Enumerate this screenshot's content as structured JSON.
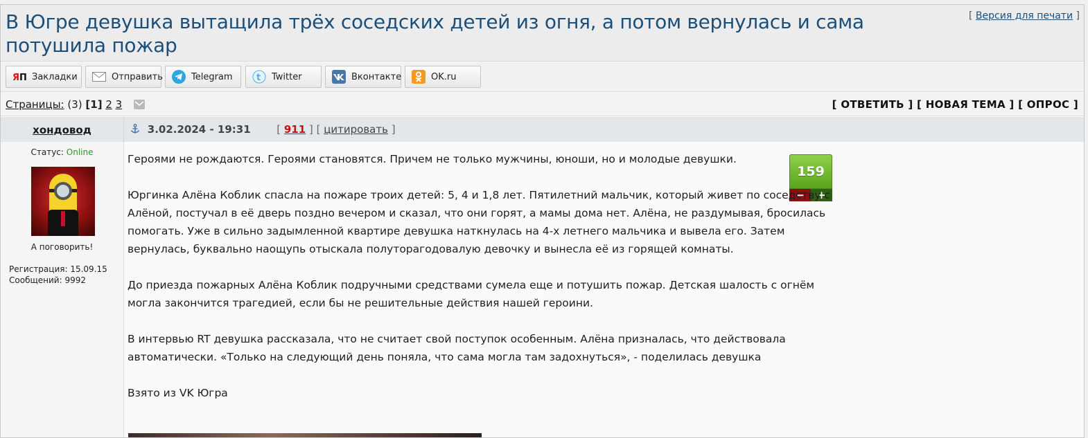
{
  "topic": {
    "title": "В Югре девушка вытащила трёх соседских детей из огня, а потом вернулась и сама потушила пожар",
    "print_open": "[",
    "print_label": "Версия для печати",
    "print_close": "]"
  },
  "share": [
    {
      "label": "Закладки",
      "icon": "yandex-bookmarks-icon",
      "color": "#e01010"
    },
    {
      "label": "Отправить",
      "icon": "mail-icon",
      "color": "#888888"
    },
    {
      "label": "Telegram",
      "icon": "telegram-icon",
      "color": "#2ca5e0"
    },
    {
      "label": "Twitter",
      "icon": "twitter-icon",
      "color": "#55acee"
    },
    {
      "label": "Вконтакте",
      "icon": "vk-icon",
      "color": "#4a76a8"
    },
    {
      "label": "OK.ru",
      "icon": "ok-icon",
      "color": "#f59a1e"
    }
  ],
  "pager": {
    "label": "Страницы:",
    "count": "(3)",
    "current": "[1]",
    "page2": "2",
    "page3": "3"
  },
  "actions": {
    "reply": "[ ОТВЕТИТЬ ]",
    "new_topic": "[ НОВАЯ ТЕМА ]",
    "poll": "[ ОПРОС ]"
  },
  "post": {
    "author": "хондовод",
    "date": "3.02.2024 - 19:31",
    "number": "911",
    "quote_label": "цитировать",
    "status_label": "Статус:",
    "status_value": "Online",
    "avatar_caption": "А поговорить!",
    "registration": "Регистрация: 15.09.15",
    "messages": "Сообщений: 9992",
    "rating": "159",
    "rating_minus": "−",
    "rating_plus": "+",
    "paragraphs": [
      "Героями не рождаются. Героями становятся. Причем не только мужчины, юноши, но и молодые девушки.",
      "Юргинка Алёна Коблик спасла на пожаре троих детей: 5, 4 и 1,8 лет. Пятилетний мальчик, который живет по соседству с Алёной, постучал в её дверь поздно вечером и сказал, что они горят, а мамы дома нет. Алёна, не раздумывая, бросилась помогать. Уже в сильно задымленной квартире девушка наткнулась на 4-х летнего мальчика и вывела его. Затем вернулась, буквально наощупь отыскала полуторагодовалую девочку и вынесла её из горящей комнаты.",
      "До приезда пожарных Алёна Коблик подручными средствами сумела еще и потушить пожар. Детская шалость с огнём могла закончится трагедией, если бы не решительные действия нашей героини.",
      "В интервью RT девушка рассказала, что не считает свой поступок особенным. Алёна призналась, что действовала автоматически. «Только на следующий день поняла, что сама могла там задохнуться», - поделилась девушка",
      "Взято из VK Югра"
    ]
  }
}
